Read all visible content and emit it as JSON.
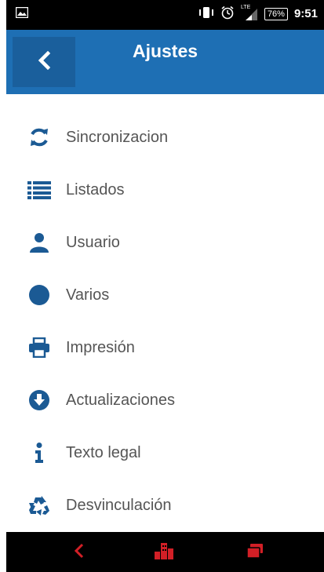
{
  "status_bar": {
    "battery": "76%",
    "time": "9:51",
    "network": "LTE"
  },
  "app_bar": {
    "title": "Ajustes"
  },
  "menu": [
    {
      "label": "Sincronizacion",
      "icon": "sync-icon"
    },
    {
      "label": "Listados",
      "icon": "list-icon"
    },
    {
      "label": "Usuario",
      "icon": "user-icon"
    },
    {
      "label": "Varios",
      "icon": "circle-icon"
    },
    {
      "label": "Impresión",
      "icon": "printer-icon"
    },
    {
      "label": "Actualizaciones",
      "icon": "download-circle-icon"
    },
    {
      "label": "Texto legal",
      "icon": "info-icon"
    },
    {
      "label": "Desvinculación",
      "icon": "recycle-icon"
    }
  ],
  "colors": {
    "accent": "#1e6fb4",
    "icon": "#1b5a94",
    "nav_icons": "#d21f26"
  }
}
